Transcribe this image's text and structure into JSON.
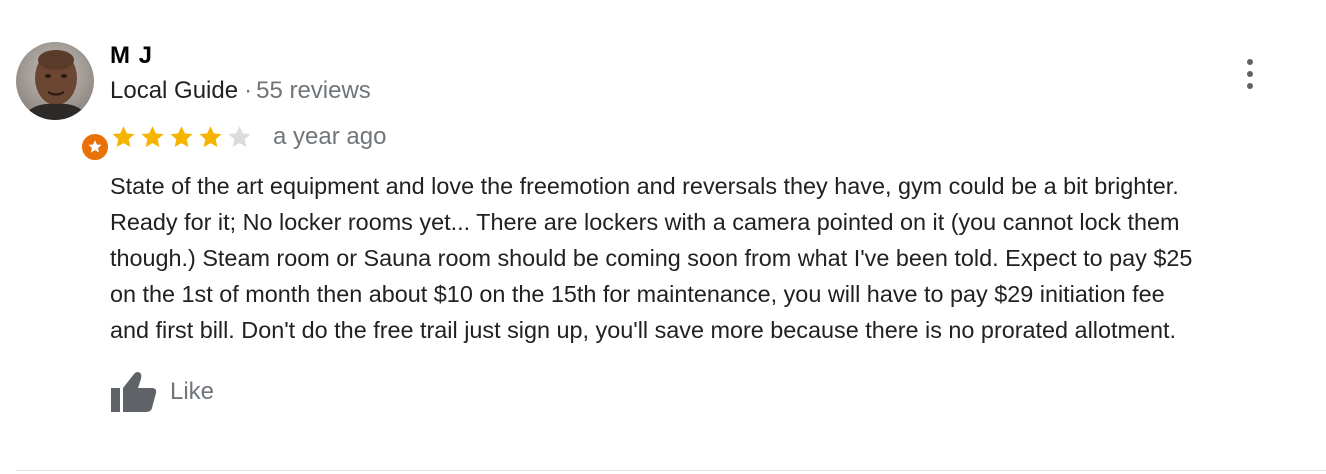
{
  "review": {
    "author": "M J",
    "author_level": "Local Guide",
    "separator": "·",
    "review_count": "55 reviews",
    "rating": 4,
    "rating_max": 5,
    "date": "a year ago",
    "text_lines": [
      "State of the art equipment and love the freemotion and reversals they have, gym could be a bit brighter.",
      "Ready for it; No locker rooms yet... There are lockers with a camera pointed on it (you cannot lock them",
      "though.) Steam room or Sauna room should be coming soon from what I've been told. Expect to pay $25",
      "on the 1st of month then about $10 on the 15th for maintenance, you will have to pay $29 initiation fee",
      "and first bill. Don't do the free trail just sign up, you'll save more because there is no prorated allotment."
    ],
    "like_label": "Like"
  },
  "icons": {
    "menu": "more-vert-icon",
    "like": "thumb-up-icon",
    "badge": "local-guide-star-icon"
  },
  "colors": {
    "star_filled": "#f4b400",
    "star_empty": "#dadce0",
    "badge": "#e8710a",
    "secondary_text": "#70757a"
  }
}
